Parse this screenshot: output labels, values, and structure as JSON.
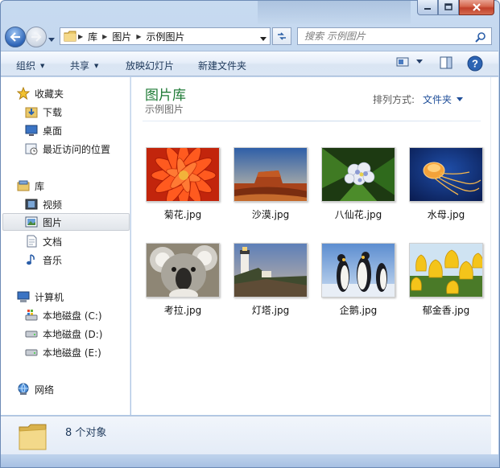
{
  "window": {
    "caption_buttons": [
      "minimize-icon",
      "maximize-icon",
      "close-icon"
    ]
  },
  "address_bar": {
    "breadcrumbs": [
      "库",
      "图片",
      "示例图片"
    ],
    "icon": "folder-icon"
  },
  "search": {
    "placeholder": "搜索 示例图片",
    "icon": "magnifier-icon"
  },
  "toolbar": {
    "organize": "组织",
    "share": "共享",
    "slideshow": "放映幻灯片",
    "new_folder": "新建文件夹",
    "right_icons": [
      "view-options-icon",
      "preview-pane-icon",
      "help-icon"
    ]
  },
  "nav": {
    "favorites": {
      "label": "收藏夹",
      "items": [
        {
          "label": "下载",
          "icon": "download-folder-icon"
        },
        {
          "label": "桌面",
          "icon": "desktop-icon"
        },
        {
          "label": "最近访问的位置",
          "icon": "recent-places-icon"
        }
      ]
    },
    "libraries": {
      "label": "库",
      "items": [
        {
          "label": "视频",
          "icon": "video-icon"
        },
        {
          "label": "图片",
          "icon": "pictures-icon",
          "selected": true
        },
        {
          "label": "文档",
          "icon": "documents-icon"
        },
        {
          "label": "音乐",
          "icon": "music-icon"
        }
      ]
    },
    "computer": {
      "label": "计算机",
      "items": [
        {
          "label": "本地磁盘 (C:)",
          "icon": "windows-drive-icon"
        },
        {
          "label": "本地磁盘 (D:)",
          "icon": "drive-icon"
        },
        {
          "label": "本地磁盘 (E:)",
          "icon": "drive-icon"
        }
      ]
    },
    "network": {
      "label": "网络",
      "icon": "network-icon"
    }
  },
  "library_header": {
    "title": "图片库",
    "subtitle": "示例图片",
    "arrange_label": "排列方式:",
    "arrange_value": "文件夹"
  },
  "files": [
    {
      "name": "菊花.jpg",
      "thumb": "chrysanthemum"
    },
    {
      "name": "沙漠.jpg",
      "thumb": "desert"
    },
    {
      "name": "八仙花.jpg",
      "thumb": "hydrangeas"
    },
    {
      "name": "水母.jpg",
      "thumb": "jellyfish"
    },
    {
      "name": "考拉.jpg",
      "thumb": "koala"
    },
    {
      "name": "灯塔.jpg",
      "thumb": "lighthouse"
    },
    {
      "name": "企鹅.jpg",
      "thumb": "penguins"
    },
    {
      "name": "郁金香.jpg",
      "thumb": "tulips"
    }
  ],
  "details": {
    "count_text": "8 个对象"
  }
}
